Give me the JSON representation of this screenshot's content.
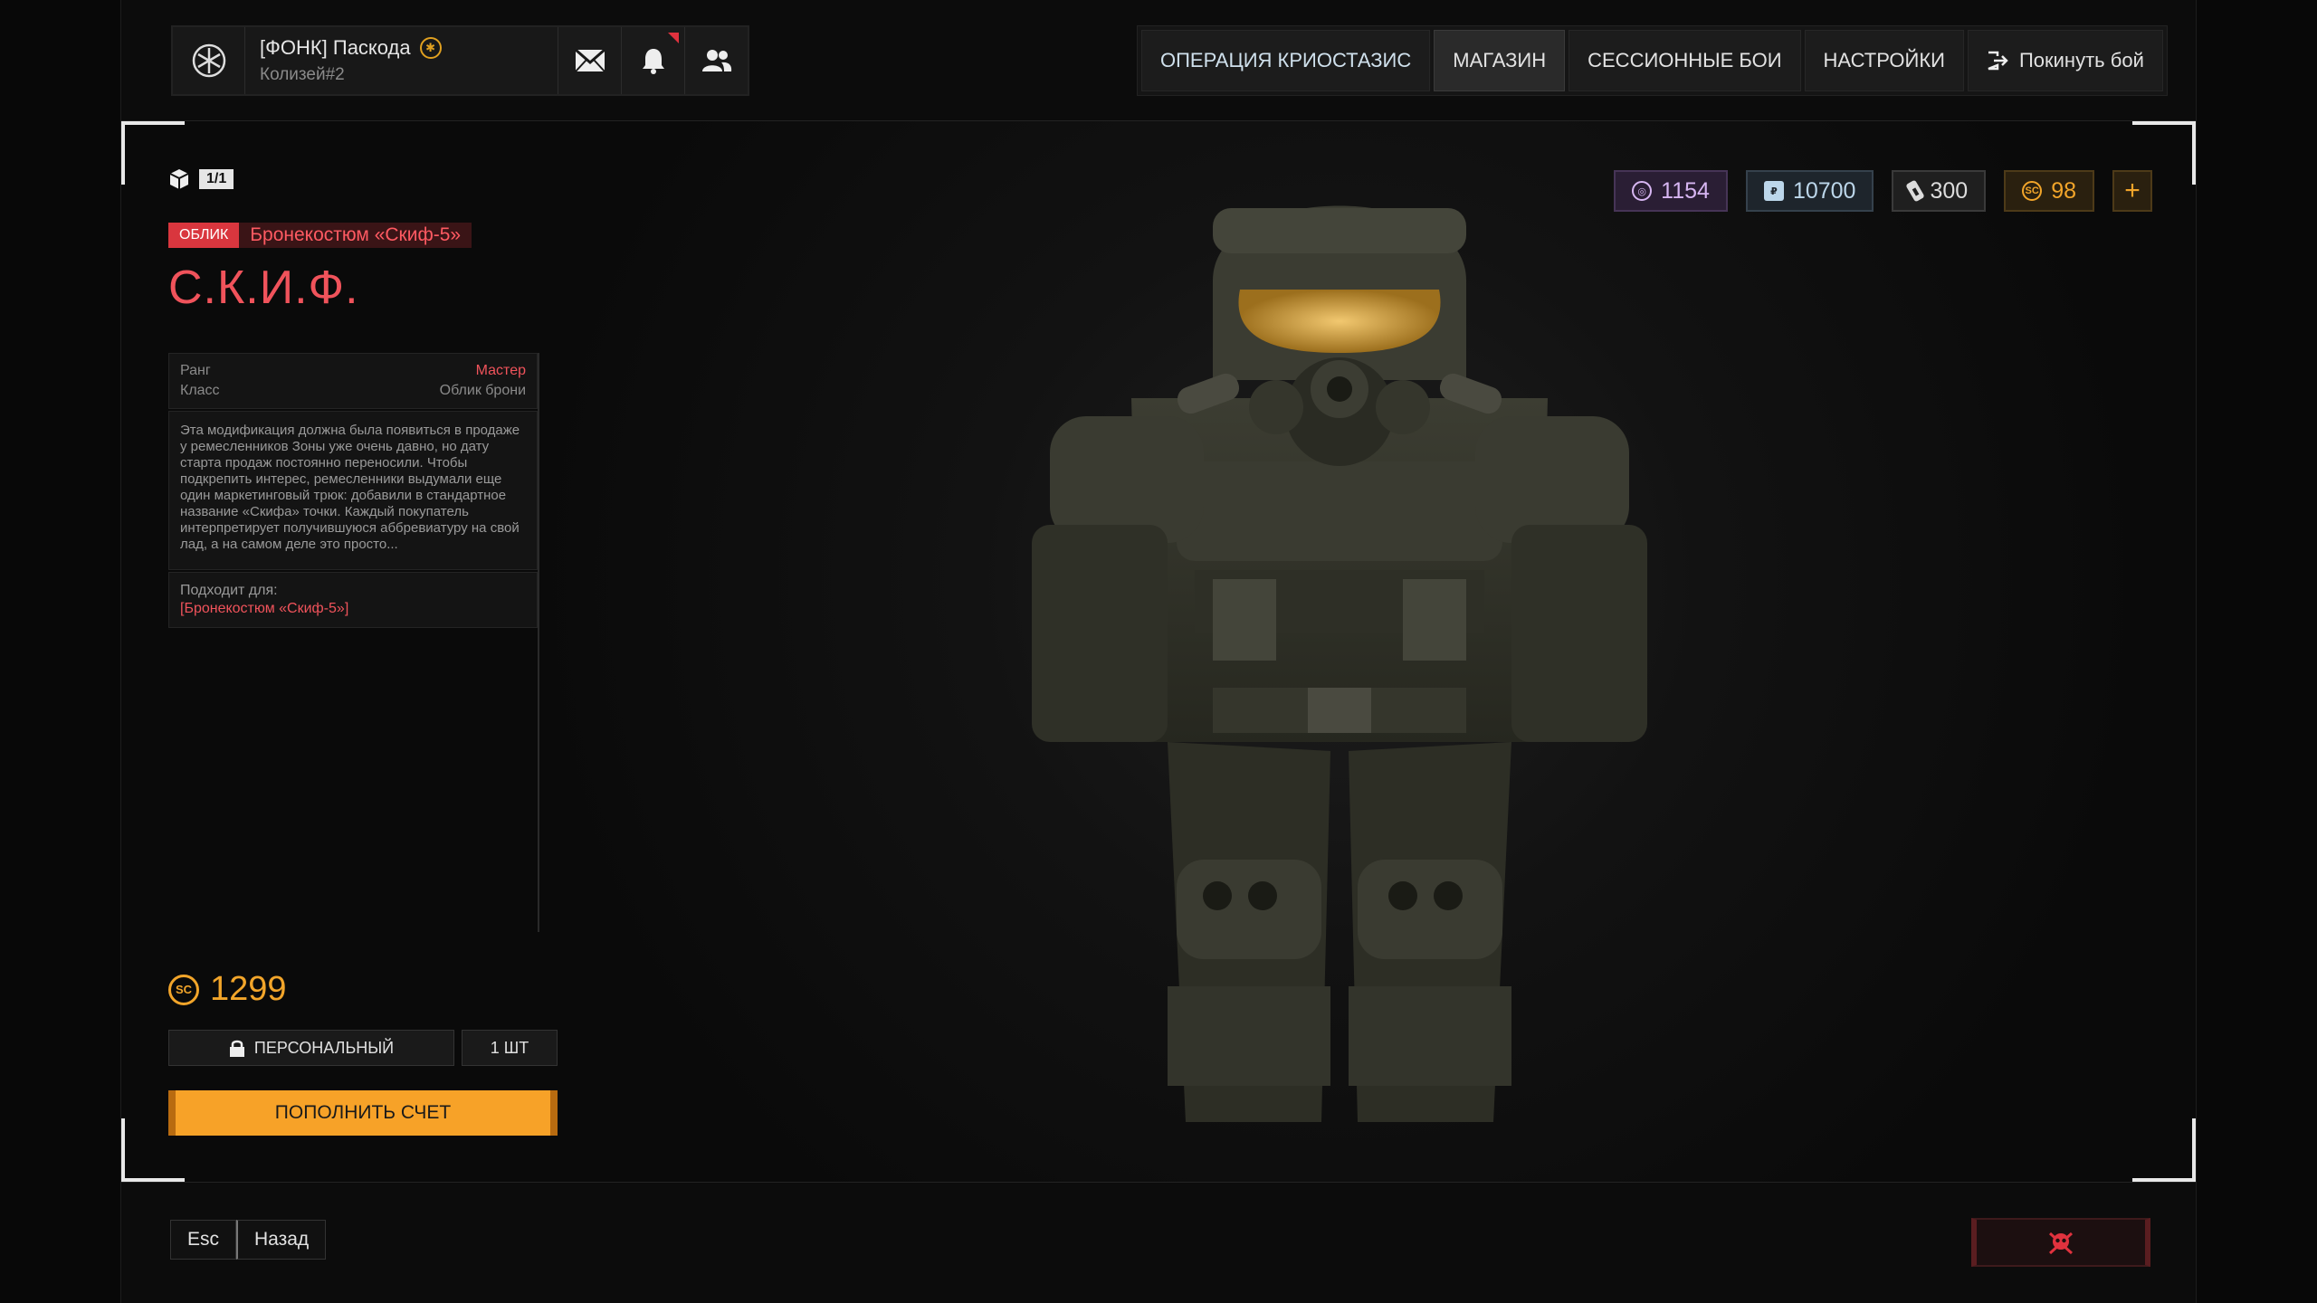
{
  "player": {
    "name": "[ФОНК] Паскода",
    "sub": "Колизей#2"
  },
  "nav": {
    "tabs": [
      {
        "label": "ОПЕРАЦИЯ КРИОСТАЗИС"
      },
      {
        "label": "МАГАЗИН"
      },
      {
        "label": "СЕССИОННЫЕ БОИ"
      },
      {
        "label": "НАСТРОЙКИ"
      },
      {
        "label": "Покинуть бой"
      }
    ]
  },
  "item": {
    "counter": "1/1",
    "tag": "ОБЛИК",
    "tag_text": "Бронекостюм «Скиф-5»",
    "title": "С.К.И.Ф.",
    "rank_label": "Ранг",
    "rank_value": "Мастер",
    "class_label": "Класс",
    "class_value": "Облик брони",
    "description": "Эта модификация должна была появиться в продаже у ремесленников Зоны уже очень давно, но дату старта продаж постоянно переносили. Чтобы подкрепить интерес, ремесленники выдумали еще один маркетинговый трюк: добавили в стандартное название «Скифа» точки. Каждый покупатель интерпретирует получившуюся аббревиатуру на свой лад, а на самом деле это просто...",
    "fits_label": "Подходит для:",
    "fits_value": "[Бронекостюм «Скиф-5»]",
    "price": "1299",
    "price_currency": "SC",
    "personal_label": "ПЕРСОНАЛЬНЫЙ",
    "qty_label": "1 ШТ",
    "buy_label": "ПОПОЛНИТЬ СЧЕТ"
  },
  "currencies": {
    "purple": "1154",
    "blue": "10700",
    "gray": "300",
    "gold": "98",
    "plus": "+"
  },
  "footer": {
    "esc_key": "Esc",
    "back_label": "Назад"
  },
  "colors": {
    "accent_red": "#f0535b",
    "accent_gold": "#f2a52a",
    "buy_button": "#f7a228"
  }
}
